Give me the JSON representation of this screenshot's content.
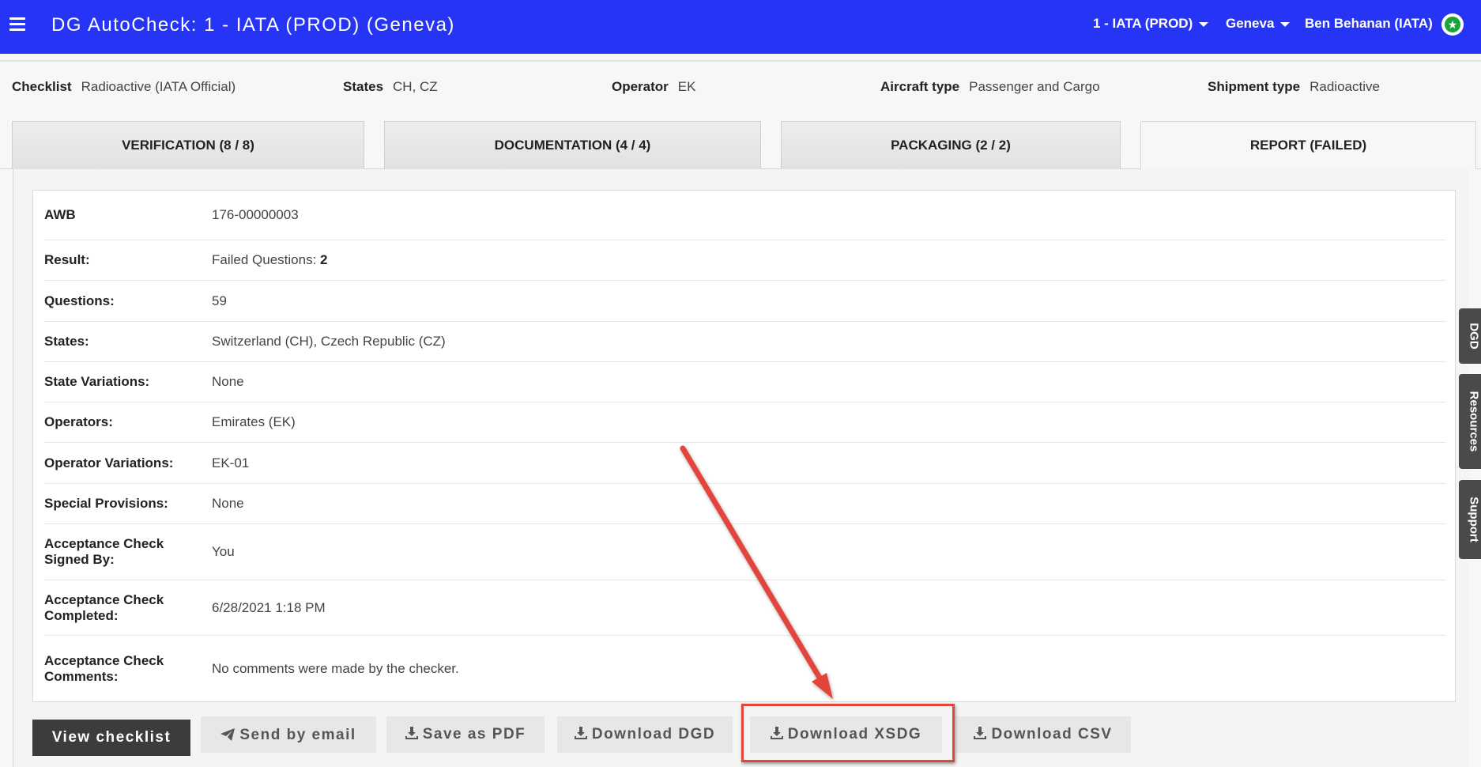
{
  "header": {
    "title": "DG AutoCheck: 1 - IATA (PROD) (Geneva)",
    "org_menu": "1 - IATA (PROD)",
    "location_menu": "Geneva",
    "user_menu": "Ben Behanan (IATA)",
    "colors": {
      "bar": "#2634f5",
      "avatar_badge": "#19a33b"
    }
  },
  "summary": {
    "checklist": {
      "label": "Checklist",
      "value": "Radioactive (IATA Official)"
    },
    "states": {
      "label": "States",
      "value": "CH, CZ"
    },
    "operator": {
      "label": "Operator",
      "value": "EK"
    },
    "aircraft": {
      "label": "Aircraft type",
      "value": "Passenger and Cargo"
    },
    "shipment": {
      "label": "Shipment type",
      "value": "Radioactive"
    }
  },
  "tabs": [
    {
      "label": "VERIFICATION (8 / 8)"
    },
    {
      "label": "DOCUMENTATION (4 / 4)"
    },
    {
      "label": "PACKAGING (2 / 2)"
    },
    {
      "label": "REPORT (FAILED)",
      "active": true
    }
  ],
  "report": {
    "awb": {
      "label": "AWB",
      "value": "176-00000003"
    },
    "result": {
      "label": "Result:",
      "prefix": "Failed Questions: ",
      "count": "2"
    },
    "questions": {
      "label": "Questions:",
      "value": "59"
    },
    "states": {
      "label": "States:",
      "value": "Switzerland (CH), Czech Republic (CZ)"
    },
    "state_variations": {
      "label": "State Variations:",
      "value": "None"
    },
    "operators": {
      "label": "Operators:",
      "value": "Emirates (EK)"
    },
    "operator_variations": {
      "label": "Operator Variations:",
      "value": "EK-01"
    },
    "special_provisions": {
      "label": "Special Provisions:",
      "value": "None"
    },
    "signed_by": {
      "label_line1": "Acceptance Check",
      "label_line2": "Signed By:",
      "value": "You"
    },
    "completed": {
      "label_line1": "Acceptance Check",
      "label_line2": "Completed:",
      "value": "6/28/2021 1:18 PM"
    },
    "comments": {
      "label_line1": "Acceptance Check",
      "label_line2": "Comments:",
      "value": "No comments were made by the checker."
    }
  },
  "side_tabs": {
    "dgd": "DGD",
    "resources": "Resources",
    "support": "Support"
  },
  "actions": {
    "view_checklist": "View checklist",
    "send_email": "Send by email",
    "save_pdf": "Save as PDF",
    "download_dgd": "Download DGD",
    "download_xsdg": "Download XSDG",
    "download_csv": "Download CSV"
  },
  "annotation": {
    "highlight_color": "#e2453a",
    "highlighted_action": "download_xsdg"
  }
}
